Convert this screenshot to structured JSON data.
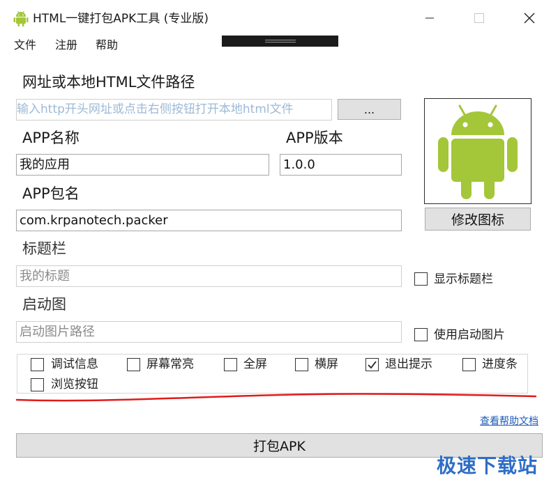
{
  "window": {
    "title": "HTML一键打包APK工具 (专业版)"
  },
  "menu": [
    "文件",
    "注册",
    "帮助"
  ],
  "url": {
    "label": "网址或本地HTML文件路径",
    "placeholder": "输入http开头网址或点击右侧按钮打开本地html文件",
    "browse_label": "..."
  },
  "app_name": {
    "label": "APP名称",
    "value": "我的应用"
  },
  "app_version": {
    "label": "APP版本",
    "value": "1.0.0"
  },
  "package": {
    "label": "APP包名",
    "value": "com.krpanotech.packer"
  },
  "titlebar": {
    "label": "标题栏",
    "placeholder": "我的标题",
    "checkbox_label": "显示标题栏",
    "checked": false
  },
  "splash": {
    "label": "启动图",
    "placeholder": "启动图片路径",
    "checkbox_label": "使用启动图片",
    "checked": false
  },
  "icon": {
    "change_label": "修改图标",
    "android_color": "#a4c639"
  },
  "options": [
    {
      "label": "调试信息",
      "checked": false
    },
    {
      "label": "屏幕常亮",
      "checked": false
    },
    {
      "label": "全屏",
      "checked": false
    },
    {
      "label": "横屏",
      "checked": false
    },
    {
      "label": "退出提示",
      "checked": true
    },
    {
      "label": "进度条",
      "checked": false
    },
    {
      "label": "浏览按钮",
      "checked": false
    }
  ],
  "help_link": "查看帮助文档",
  "pack_button": "打包APK",
  "watermark": "极速下载站",
  "colors": {
    "annotation_red": "#e01b1b",
    "link": "#1e5bb8"
  }
}
